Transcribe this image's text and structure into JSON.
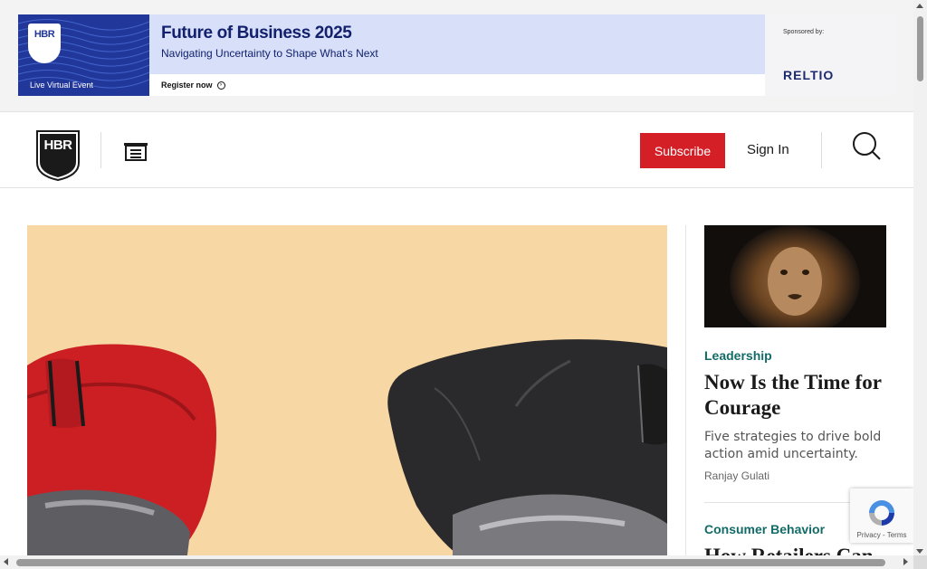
{
  "ad": {
    "badge_text": "HBR",
    "event_type": "Live Virtual Event",
    "title": "Future of Business 2025",
    "subtitle": "Navigating Uncertainty to Shape What's Next",
    "cta": "Register now",
    "sponsor_label": "Sponsored by:",
    "sponsor_name": "RELTIO",
    "colors": {
      "primary": "#22379a",
      "panel": "#d7e0f8"
    }
  },
  "header": {
    "logo_text": "HBR",
    "menu_icon": "menu-icon",
    "subscribe_label": "Subscribe",
    "signin_label": "Sign In",
    "search_icon": "search-icon",
    "accent_color": "#d41f26"
  },
  "hero": {
    "image": "boxing-gloves-vs-computer-mouse",
    "background_color": "#f7d7a4"
  },
  "sidebar": {
    "articles": [
      {
        "image": "lion-portrait",
        "category": "Leadership",
        "title": "Now Is the Time for Courage",
        "dek": "Five strategies to drive bold action amid uncertainty.",
        "author": "Ranjay Gulati"
      },
      {
        "category": "Consumer Behavior",
        "title": "How Retailers Can"
      }
    ],
    "category_color": "#136b67"
  },
  "recaptcha": {
    "terms": "Privacy - Terms"
  }
}
